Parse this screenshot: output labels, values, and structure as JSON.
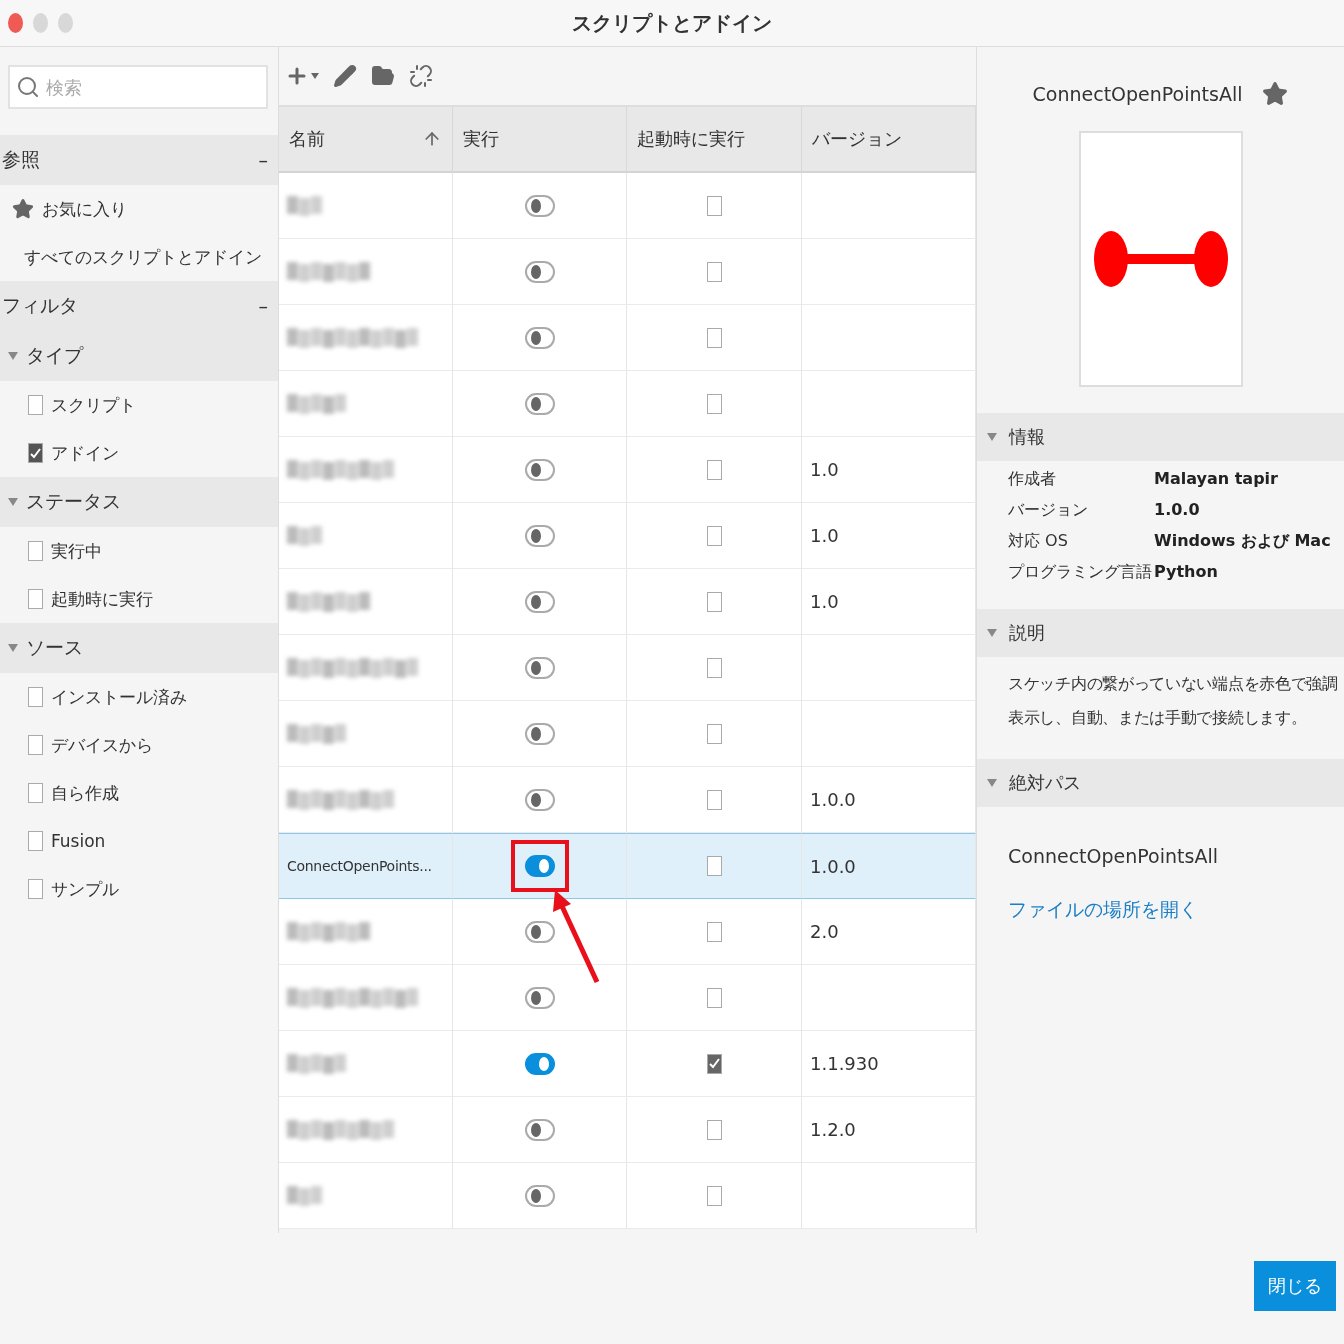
{
  "window": {
    "title": "スクリプトとアドイン"
  },
  "search": {
    "placeholder": "検索"
  },
  "sidebar": {
    "sections": [
      {
        "title": "参照",
        "collapse": "–",
        "items": [
          {
            "label": "お気に入り",
            "kind": "favorite"
          },
          {
            "label": "すべてのスクリプトとアドイン",
            "kind": "plain"
          }
        ]
      },
      {
        "title": "フィルタ",
        "collapse": "–",
        "groups": [
          {
            "title": "タイプ",
            "expanded": true,
            "options": [
              {
                "label": "スクリプト",
                "checked": false
              },
              {
                "label": "アドイン",
                "checked": true
              }
            ]
          },
          {
            "title": "ステータス",
            "expanded": true,
            "options": [
              {
                "label": "実行中",
                "checked": false
              },
              {
                "label": "起動時に実行",
                "checked": false
              }
            ]
          },
          {
            "title": "ソース",
            "expanded": true,
            "options": [
              {
                "label": "インストール済み",
                "checked": false
              },
              {
                "label": "デバイスから",
                "checked": false
              },
              {
                "label": "自ら作成",
                "checked": false
              },
              {
                "label": "Fusion",
                "checked": false
              },
              {
                "label": "サンプル",
                "checked": false
              }
            ]
          }
        ]
      }
    ]
  },
  "table": {
    "columns": [
      {
        "label": "名前",
        "sorted": true
      },
      {
        "label": "実行",
        "sorted": false
      },
      {
        "label": "起動時に実行",
        "sorted": false
      },
      {
        "label": "バージョン",
        "sorted": false
      }
    ],
    "rows": [
      {
        "hidden_name": true,
        "running": false,
        "startup": false,
        "selected": false
      },
      {
        "hidden_name": true,
        "running": false,
        "startup": false,
        "selected": false
      },
      {
        "hidden_name": true,
        "running": false,
        "startup": false,
        "selected": false
      },
      {
        "hidden_name": true,
        "running": false,
        "startup": false,
        "selected": false
      },
      {
        "hidden_name": true,
        "running": false,
        "startup": false,
        "version": "1.0",
        "selected": false
      },
      {
        "hidden_name": true,
        "running": false,
        "startup": false,
        "version": "1.0",
        "selected": false
      },
      {
        "hidden_name": true,
        "running": false,
        "startup": false,
        "version": "1.0",
        "selected": false
      },
      {
        "hidden_name": true,
        "running": false,
        "startup": false,
        "selected": false
      },
      {
        "hidden_name": true,
        "running": false,
        "startup": false,
        "selected": false
      },
      {
        "hidden_name": true,
        "running": false,
        "startup": false,
        "version": "1.0.0",
        "selected": false
      },
      {
        "name": "ConnectOpenPoints...",
        "running": true,
        "startup": false,
        "version": "1.0.0",
        "selected": true,
        "highlighted": true
      },
      {
        "hidden_name": true,
        "running": false,
        "startup": false,
        "version": "2.0",
        "selected": false
      },
      {
        "hidden_name": true,
        "running": false,
        "startup": false,
        "selected": false
      },
      {
        "hidden_name": true,
        "running": true,
        "startup": true,
        "version": "1.1.930",
        "selected": false
      },
      {
        "hidden_name": true,
        "running": false,
        "startup": false,
        "version": "1.2.0",
        "selected": false
      },
      {
        "hidden_name": true,
        "running": false,
        "startup": false,
        "selected": false
      }
    ]
  },
  "details": {
    "title": "ConnectOpenPointsAll",
    "favorite": true,
    "info": {
      "title": "情報",
      "expanded": true,
      "rows": [
        {
          "label": "作成者",
          "value": "Malayan tapir"
        },
        {
          "label": "バージョン",
          "value": "1.0.0"
        },
        {
          "label": "対応 OS",
          "value": "Windows および Mac"
        },
        {
          "label": "プログラミング言語",
          "value": "Python"
        }
      ]
    },
    "description": {
      "title": "説明",
      "expanded": true,
      "text": "スケッチ内の繋がっていない端点を赤色で強調表示し、自動、または手動で接続します。"
    },
    "path": {
      "title": "絶対パス",
      "expanded": true,
      "value": "ConnectOpenPointsAll",
      "link": "ファイルの場所を開く"
    }
  },
  "buttons": [
    {
      "label": "閉じる"
    }
  ]
}
